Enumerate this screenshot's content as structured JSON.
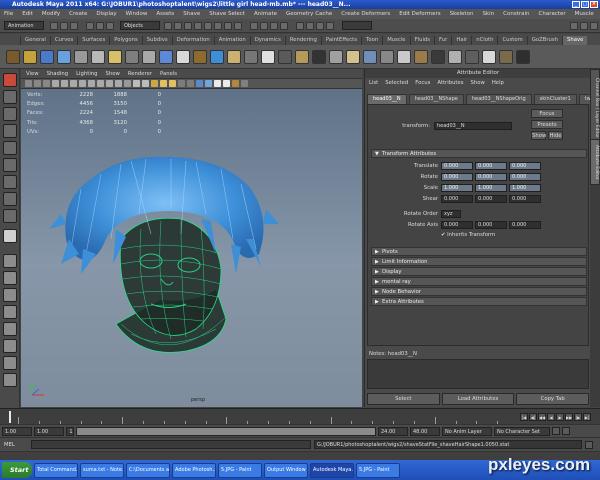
{
  "window": {
    "title": "Autodesk Maya 2011 x64: G:\\JOBUR1\\photoshoptalent\\wigs2\\little girl head-mb.mb*   ---   head03__N..."
  },
  "menubar": [
    "File",
    "Edit",
    "Modify",
    "Create",
    "Display",
    "Window",
    "Assets",
    "Shave",
    "Shave Select",
    "Animate",
    "Geometry Cache",
    "Create Deformers",
    "Edit Deformers",
    "Skeleton",
    "Skin",
    "Constrain",
    "Character",
    "Muscle",
    "Help"
  ],
  "statusline": {
    "menuset": "Animation",
    "objects_label": "Objects"
  },
  "shelf_tabs": [
    "General",
    "Curves",
    "Surfaces",
    "Polygons",
    "Subdivs",
    "Deformation",
    "Animation",
    "Dynamics",
    "Rendering",
    "PaintEffects",
    "Toon",
    "Muscle",
    "Fluids",
    "Fur",
    "Hair",
    "nCloth",
    "Custom",
    "GoZBrush",
    "Shave"
  ],
  "shelf_active_tab": "Shave",
  "viewport": {
    "menu": [
      "View",
      "Shading",
      "Lighting",
      "Show",
      "Renderer",
      "Panels"
    ],
    "hud": [
      {
        "label": "Verts:",
        "v1": "2228",
        "v2": "1888",
        "v3": "0"
      },
      {
        "label": "Edges:",
        "v1": "4456",
        "v2": "3150",
        "v3": "0"
      },
      {
        "label": "Faces:",
        "v1": "2224",
        "v2": "1548",
        "v3": "0"
      },
      {
        "label": "Tris:",
        "v1": "4368",
        "v2": "3120",
        "v3": "0"
      },
      {
        "label": "UVs:",
        "v1": "0",
        "v2": "0",
        "v3": "0"
      }
    ],
    "camera_label": "persp"
  },
  "attribute_editor": {
    "title": "Attribute Editor",
    "menu": [
      "List",
      "Selected",
      "Focus",
      "Attributes",
      "Show",
      "Help"
    ],
    "tabs": [
      "head03__N",
      "head03__NShape",
      "head03__NShapeOrig",
      "skinCluster1",
      "tweak"
    ],
    "active_tab": "head03__N",
    "transform_label": "transform:",
    "transform_name": "head03__N",
    "focus_btn": "Focus",
    "presets_btn": "Presets",
    "show_btn": "Show",
    "hide_btn": "Hide",
    "transform_section": "Transform Attributes",
    "rows": [
      {
        "label": "Translate",
        "x": "0.000",
        "y": "0.000",
        "z": "0.000",
        "highlight": true
      },
      {
        "label": "Rotate",
        "x": "0.000",
        "y": "0.000",
        "z": "0.000",
        "highlight": true
      },
      {
        "label": "Scale",
        "x": "1.000",
        "y": "1.000",
        "z": "1.000",
        "highlight": true
      },
      {
        "label": "Shear",
        "x": "0.000",
        "y": "0.000",
        "z": "0.000",
        "highlight": false
      }
    ],
    "rotate_order_label": "Rotate Order",
    "rotate_order_value": "xyz",
    "rotate_axis_label": "Rotate Axis",
    "rotate_axis": [
      "0.000",
      "0.000",
      "0.000"
    ],
    "inherits_label": "Inherits Transform",
    "sections": [
      "Pivots",
      "Limit Information",
      "Display",
      "mental ray",
      "Node Behavior",
      "Extra Attributes"
    ],
    "notes_label": "Notes: head03__N",
    "buttons": [
      "Select",
      "Load Attributes",
      "Copy Tab"
    ]
  },
  "side_tabs": [
    "Channel Box / Layer Editor",
    "Attribute Editor"
  ],
  "time": {
    "start": "1.00",
    "start2": "1.00",
    "current": "1",
    "end": "24.00",
    "end2": "48.00",
    "tick_labels": [
      "1",
      "2",
      "3",
      "4",
      "5",
      "6",
      "7",
      "8",
      "9",
      "10",
      "11",
      "12",
      "13",
      "14",
      "15",
      "16",
      "17",
      "18",
      "19",
      "20",
      "21",
      "22",
      "23",
      "24"
    ],
    "current_frame_field": "1.00",
    "anim_layer": "No Anim Layer",
    "char_set": "No Character Set"
  },
  "cmdline": {
    "label": "MEL",
    "result": "G:/JOBUR1/photoshoptalent/wigs2/shaveStatFile_shaveHairShape1.0050.stat"
  },
  "taskbar": {
    "start": "Start",
    "tasks": [
      "Total Command...",
      "suma.txt - Note...",
      "C:\\Documents a...",
      "Adobe Photosh...",
      "5.JPG - Paint",
      "Output Window",
      "Autodesk Maya...",
      "5.JPG - Paint"
    ],
    "active_task": "Autodesk Maya..."
  },
  "watermark": "pxleyes.com",
  "colors": {
    "hair": "#3d8fd8",
    "wireframe": "#29e08a",
    "title_blue": "#2a5bd0"
  }
}
